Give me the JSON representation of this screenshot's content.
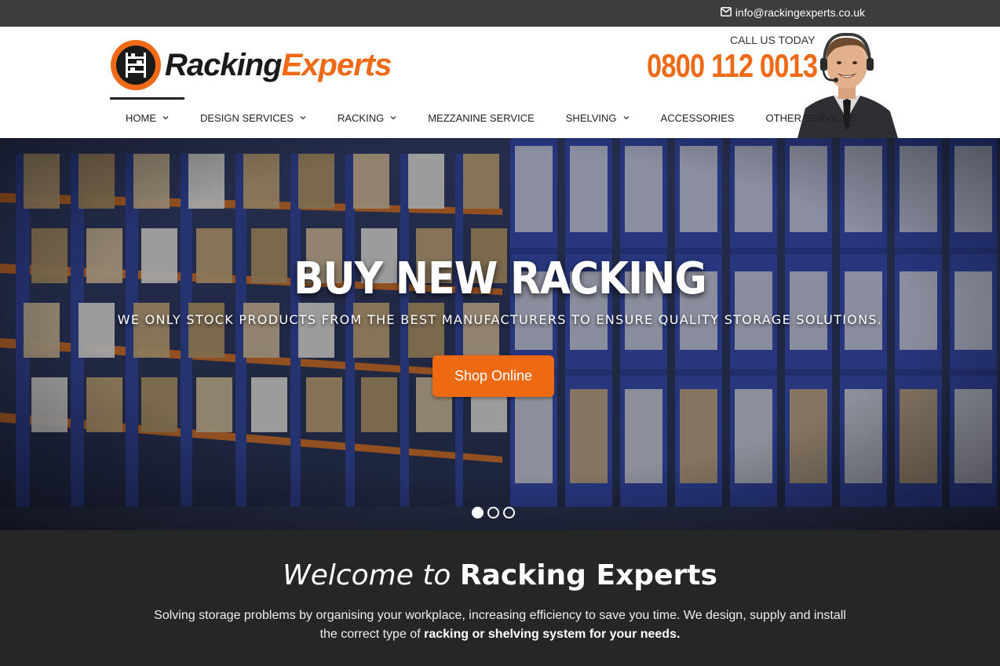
{
  "topbar": {
    "email": "info@rackingexperts.co.uk",
    "email_icon": "envelope-icon"
  },
  "header": {
    "logo_part1": "Racking",
    "logo_part2": "Experts",
    "call_label": "CALL US TODAY",
    "phone": "0800 112 0013",
    "agent_image": "customer-service-agent-with-headset"
  },
  "nav": {
    "items": [
      {
        "label": "HOME",
        "has_dropdown": true,
        "active": true
      },
      {
        "label": "DESIGN SERVICES",
        "has_dropdown": true
      },
      {
        "label": "RACKING",
        "has_dropdown": true
      },
      {
        "label": "MEZZANINE SERVICE",
        "has_dropdown": false
      },
      {
        "label": "SHELVING",
        "has_dropdown": true
      },
      {
        "label": "ACCESSORIES",
        "has_dropdown": false
      },
      {
        "label": "OTHER SERVICES",
        "has_dropdown": true
      }
    ]
  },
  "hero": {
    "title": "BUY NEW RACKING",
    "subtitle": "WE ONLY STOCK PRODUCTS FROM THE BEST MANUFACTURERS TO ENSURE QUALITY STORAGE SOLUTIONS.",
    "button_label": "Shop Online",
    "slides_count": 3,
    "active_slide": 1
  },
  "welcome": {
    "title_light": "Welcome to",
    "title_bold": "Racking Experts",
    "text_regular": "Solving storage problems by organising your workplace, increasing efficiency to save you time. We design, supply and install the correct type of",
    "text_bold": "racking or shelving system for your needs."
  },
  "colors": {
    "brand_orange": "#ef6a16",
    "topbar_bg": "#3d3d3d",
    "footer_bg": "#262626"
  }
}
